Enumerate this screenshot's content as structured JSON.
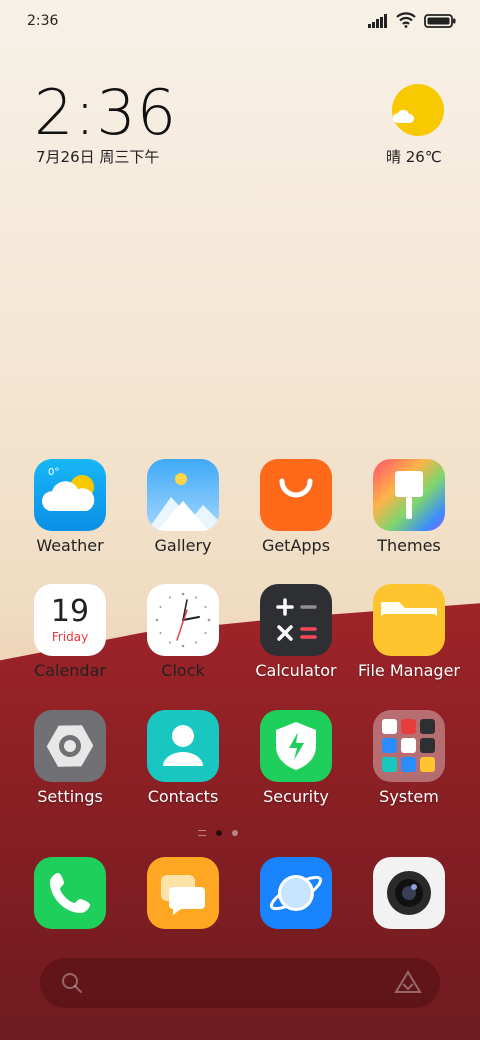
{
  "status_bar": {
    "time": "2:36"
  },
  "clock_widget": {
    "time": "2:36",
    "date": "7月26日 周三下午"
  },
  "weather_widget": {
    "text": "晴 26℃"
  },
  "apps": [
    {
      "label": "Weather",
      "temp": "0°"
    },
    {
      "label": "Gallery"
    },
    {
      "label": "GetApps"
    },
    {
      "label": "Themes"
    },
    {
      "label": "Calendar",
      "day": "19",
      "weekday": "Friday"
    },
    {
      "label": "Clock"
    },
    {
      "label": "Calculator"
    },
    {
      "label": "File Manager"
    },
    {
      "label": "Settings"
    },
    {
      "label": "Contacts"
    },
    {
      "label": "Security"
    },
    {
      "label": "System"
    }
  ],
  "page_indicator": {
    "pages": 2,
    "active": 1
  },
  "dock": [
    {
      "name": "phone"
    },
    {
      "name": "messages"
    },
    {
      "name": "browser"
    },
    {
      "name": "camera"
    }
  ],
  "colors": {
    "accent_red": "#c22f33",
    "sun": "#f8c800"
  }
}
